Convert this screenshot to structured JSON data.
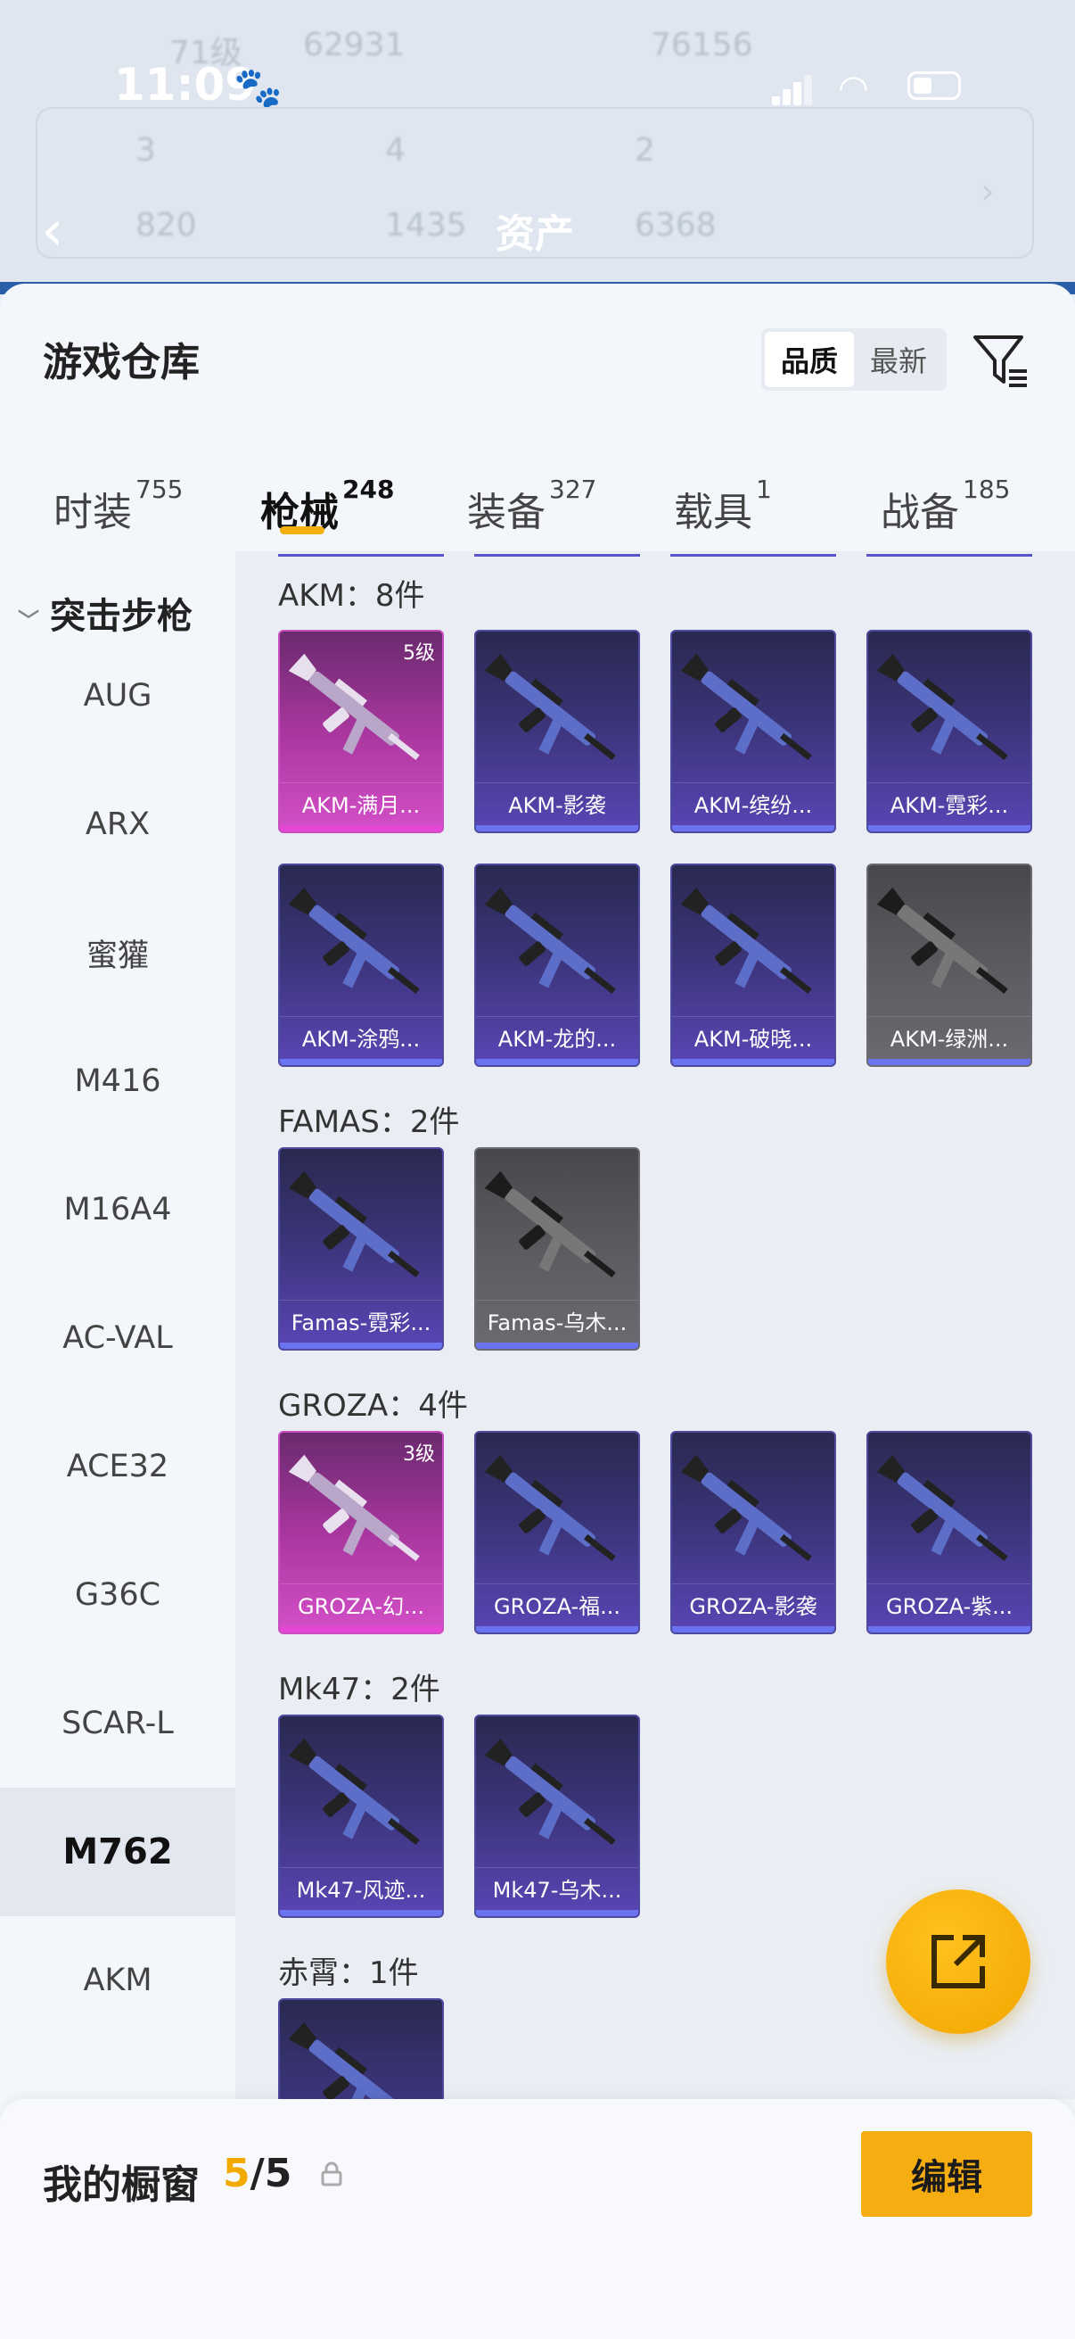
{
  "status_bar": {
    "time": "11:09"
  },
  "header": {
    "title": "资产",
    "bg_levels": [
      "71级",
      "62931",
      "76156"
    ],
    "bg_stats": [
      "3",
      "4",
      "2",
      "820",
      "1435",
      "6368"
    ]
  },
  "sheet": {
    "title": "游戏仓库",
    "sort_options": [
      "品质",
      "最新"
    ],
    "active_sort": "品质",
    "tabs": [
      {
        "label": "时装",
        "count": "755"
      },
      {
        "label": "枪械",
        "count": "248"
      },
      {
        "label": "装备",
        "count": "327"
      },
      {
        "label": "载具",
        "count": "1"
      },
      {
        "label": "战备",
        "count": "185"
      }
    ],
    "active_tab": "枪械"
  },
  "sidebar": {
    "category": "突击步枪",
    "items": [
      "AUG",
      "ARX",
      "蜜獾",
      "M416",
      "M16A4",
      "AC-VAL",
      "ACE32",
      "G36C",
      "SCAR-L",
      "M762",
      "AKM"
    ],
    "active": "M762"
  },
  "sections": [
    {
      "title": "AKM：8件",
      "cards": [
        {
          "name": "AKM-满月...",
          "level": "5级",
          "style": "gold"
        },
        {
          "name": "AKM-影袭",
          "level": "",
          "style": "purple"
        },
        {
          "name": "AKM-缤纷...",
          "level": "",
          "style": "purple"
        },
        {
          "name": "AKM-霓彩...",
          "level": "",
          "style": "purple"
        },
        {
          "name": "AKM-涂鸦...",
          "level": "",
          "style": "purple"
        },
        {
          "name": "AKM-龙的...",
          "level": "",
          "style": "purple"
        },
        {
          "name": "AKM-破晓...",
          "level": "",
          "style": "purple"
        },
        {
          "name": "AKM-绿洲...",
          "level": "",
          "style": "gray"
        }
      ]
    },
    {
      "title": "FAMAS：2件",
      "cards": [
        {
          "name": "Famas-霓彩...",
          "level": "",
          "style": "purple"
        },
        {
          "name": "Famas-乌木...",
          "level": "",
          "style": "gray"
        }
      ]
    },
    {
      "title": "GROZA：4件",
      "cards": [
        {
          "name": "GROZA-幻...",
          "level": "3级",
          "style": "gold"
        },
        {
          "name": "GROZA-福...",
          "level": "",
          "style": "purple"
        },
        {
          "name": "GROZA-影袭",
          "level": "",
          "style": "purple"
        },
        {
          "name": "GROZA-紫...",
          "level": "",
          "style": "purple"
        }
      ]
    },
    {
      "title": "Mk47：2件",
      "cards": [
        {
          "name": "Mk47-风迹...",
          "level": "",
          "style": "purple"
        },
        {
          "name": "Mk47-乌木...",
          "level": "",
          "style": "purple"
        }
      ]
    },
    {
      "title": "赤霄：1件",
      "cards": [
        {
          "name": "",
          "level": "",
          "style": "purple"
        }
      ]
    }
  ],
  "showcase": {
    "label": "我的橱窗",
    "count_current": "5",
    "count_total": "/5",
    "edit_label": "编辑"
  },
  "colors": {
    "accent": "#f6ad12",
    "gold_card": "#d44fc8",
    "purple_card": "#5a45b5",
    "gray_card": "#5e5e64"
  },
  "icons": [
    "back-arrow-icon",
    "filter-icon",
    "chevron-down-icon",
    "share-icon",
    "lock-icon",
    "gun-icon"
  ]
}
